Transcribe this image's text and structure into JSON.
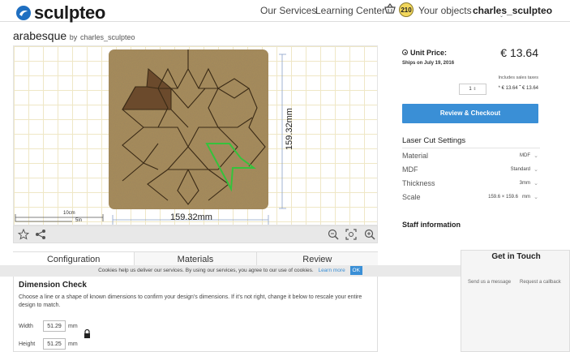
{
  "header": {
    "logo_text": "sculpteo",
    "nav": [
      "Our Services",
      "Learning Center"
    ],
    "basket_count": "210",
    "objects_label": "Your objects",
    "user_name": "charles_sculpteo"
  },
  "design": {
    "title": "arabesque",
    "by_label": "by",
    "author": "charles_sculpteo"
  },
  "viewer": {
    "width_dim": "159.32mm",
    "height_dim": "159.32mm",
    "scale_cm": "10cm",
    "scale_in": "5in",
    "colors": {
      "board": "#a88c5a",
      "selected": "#6b4a2c",
      "highlight": "#35c23c",
      "grid": "#efe7c6"
    }
  },
  "tabs": [
    "Configuration",
    "Materials",
    "Review"
  ],
  "dimension_check": {
    "title": "Dimension Check",
    "description": "Choose a line or a shape of known dimensions to confirm your design's dimensions. If it's not right, change it below to rescale your entire design to match.",
    "width_label": "Width",
    "width_value": "51.29",
    "height_label": "Height",
    "height_value": "51.25",
    "unit": "mm"
  },
  "cookie": {
    "text": "Cookies help us deliver our services. By using our services, you agree to our use of cookies.",
    "learn_more": "Learn more",
    "ok": "OK"
  },
  "price": {
    "unit_price_label": "Unit Price:",
    "value": "€ 13.64",
    "ships": "Ships on July 19, 2016",
    "tax_note": "Includes sales taxes",
    "quantity": "1",
    "calc": "* € 13.64 ˭ € 13.64",
    "checkout_label": "Review & Checkout",
    "accent": "#3a8fd6"
  },
  "laser": {
    "title": "Laser Cut Settings",
    "rows": [
      {
        "label": "Material",
        "value": "MDF"
      },
      {
        "label": "MDF",
        "value": "Standard"
      },
      {
        "label": "Thickness",
        "value": "3mm"
      },
      {
        "label": "Scale",
        "value": "159.6 × 159.6   mm"
      }
    ]
  },
  "staff_title": "Staff information",
  "touch": {
    "title": "Get in Touch",
    "send_message": "Send us a message",
    "callback": "Request a callback"
  }
}
